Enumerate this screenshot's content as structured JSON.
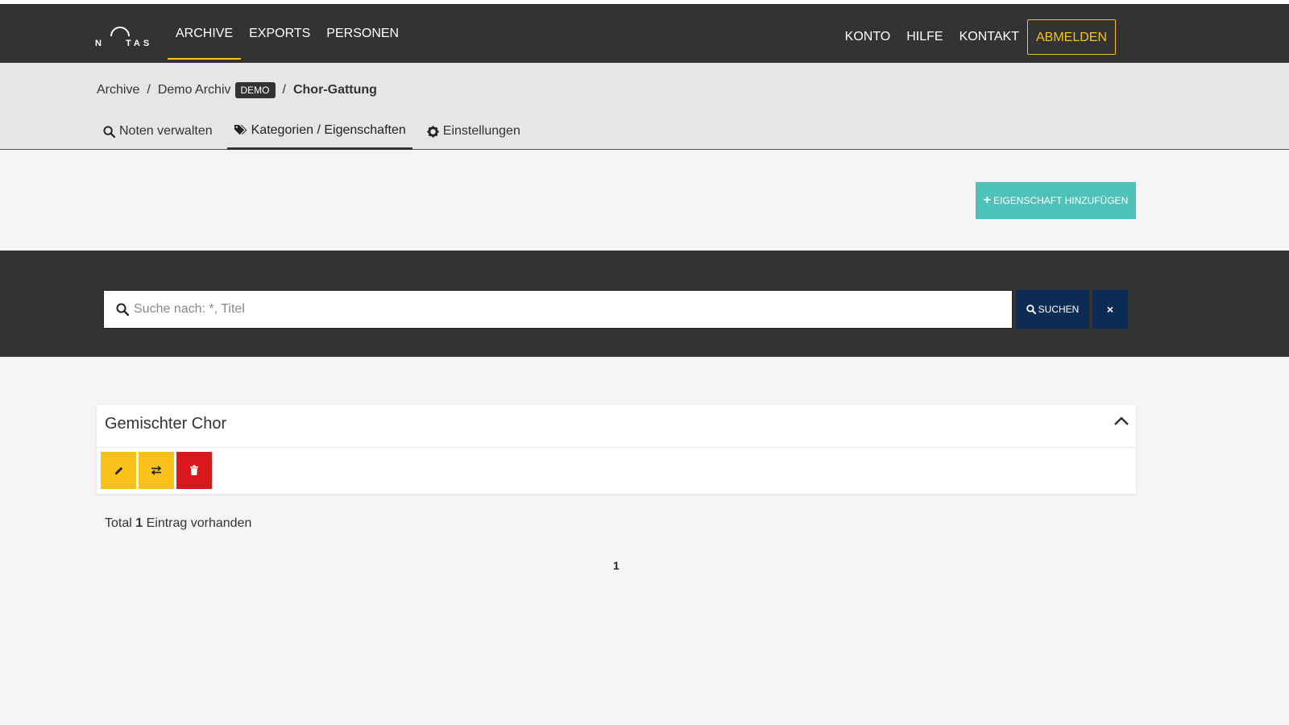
{
  "header": {
    "nav_left": [
      {
        "label": "ARCHIVE",
        "active": true
      },
      {
        "label": "EXPORTS",
        "active": false
      },
      {
        "label": "PERSONEN",
        "active": false
      }
    ],
    "nav_right": {
      "konto": "KONTO",
      "hilfe": "HILFE",
      "kontakt": "KONTAKT",
      "abmelden": "ABMELDEN"
    },
    "logo_letters": "N  T A S"
  },
  "breadcrumb": {
    "root": "Archive",
    "archive": "Demo Archiv",
    "badge": "DEMO",
    "current": "Chor-Gattung"
  },
  "tabs": [
    {
      "label": "Noten verwalten",
      "icon": "search-icon",
      "active": false
    },
    {
      "label": "Kategorien / Eigenschaften",
      "icon": "tags-icon",
      "active": true
    },
    {
      "label": "Einstellungen",
      "icon": "gear-icon",
      "active": false
    }
  ],
  "add_button": {
    "label": "EIGENSCHAFT HINZUFÜGEN"
  },
  "search": {
    "placeholder": "Suche nach: *, Titel",
    "value": "",
    "search_label": "SUCHEN",
    "clear_label": "×"
  },
  "items": [
    {
      "title": "Gemischter Chor"
    }
  ],
  "summary": {
    "prefix": "Total",
    "count": "1",
    "suffix": "Eintrag vorhanden"
  },
  "pagination": {
    "current": "1"
  },
  "colors": {
    "header_bg": "#333333",
    "accent_yellow": "#f5c518",
    "teal": "#4ec1b8",
    "navy": "#0d2c54",
    "action_yellow": "#f9c21b",
    "action_red": "#d9171d"
  }
}
